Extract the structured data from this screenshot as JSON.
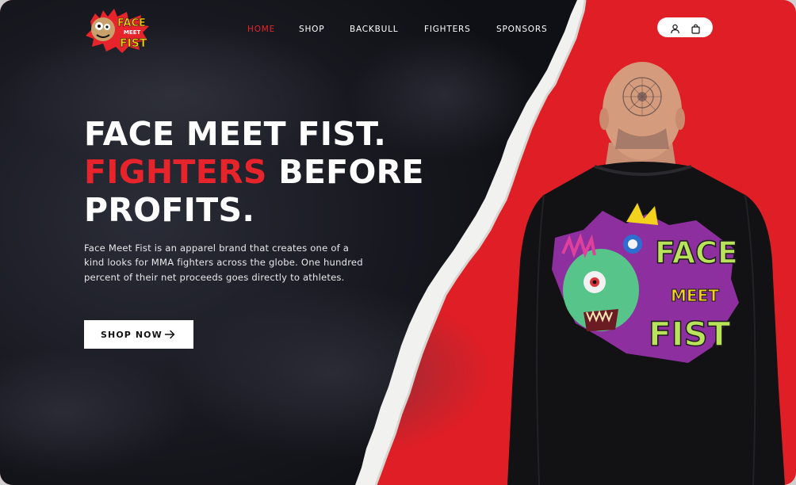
{
  "brand": {
    "logo_text_line1": "FACE",
    "logo_text_line2": "MEET",
    "logo_text_line3": "FIST"
  },
  "nav": {
    "items": [
      {
        "label": "HOME",
        "active": true
      },
      {
        "label": "SHOP",
        "active": false
      },
      {
        "label": "BACKBULL",
        "active": false
      },
      {
        "label": "FIGHTERS",
        "active": false
      },
      {
        "label": "SPONSORS",
        "active": false
      }
    ]
  },
  "header_actions": {
    "icons": [
      "user-icon",
      "shopping-bag-icon"
    ]
  },
  "hero": {
    "title_line1": "FACE MEET FIST.",
    "title_line2_red": "FIGHTERS",
    "title_line2_rest": " BEFORE",
    "title_line3": "PROFITS.",
    "description": "Face Meet Fist is an apparel brand that creates one of a kind looks for MMA fighters across the globe. One hundred percent of their net proceeds goes directly to athletes.",
    "cta_label": "SHOP NOW"
  },
  "shirt_graphic": {
    "text_line1": "FACE",
    "text_line2": "MEET",
    "text_line3": "FIST"
  },
  "colors": {
    "accent_red": "#e7242b",
    "background_red": "#e01e26",
    "dark_background": "#15161d",
    "text_white": "#ffffff"
  }
}
